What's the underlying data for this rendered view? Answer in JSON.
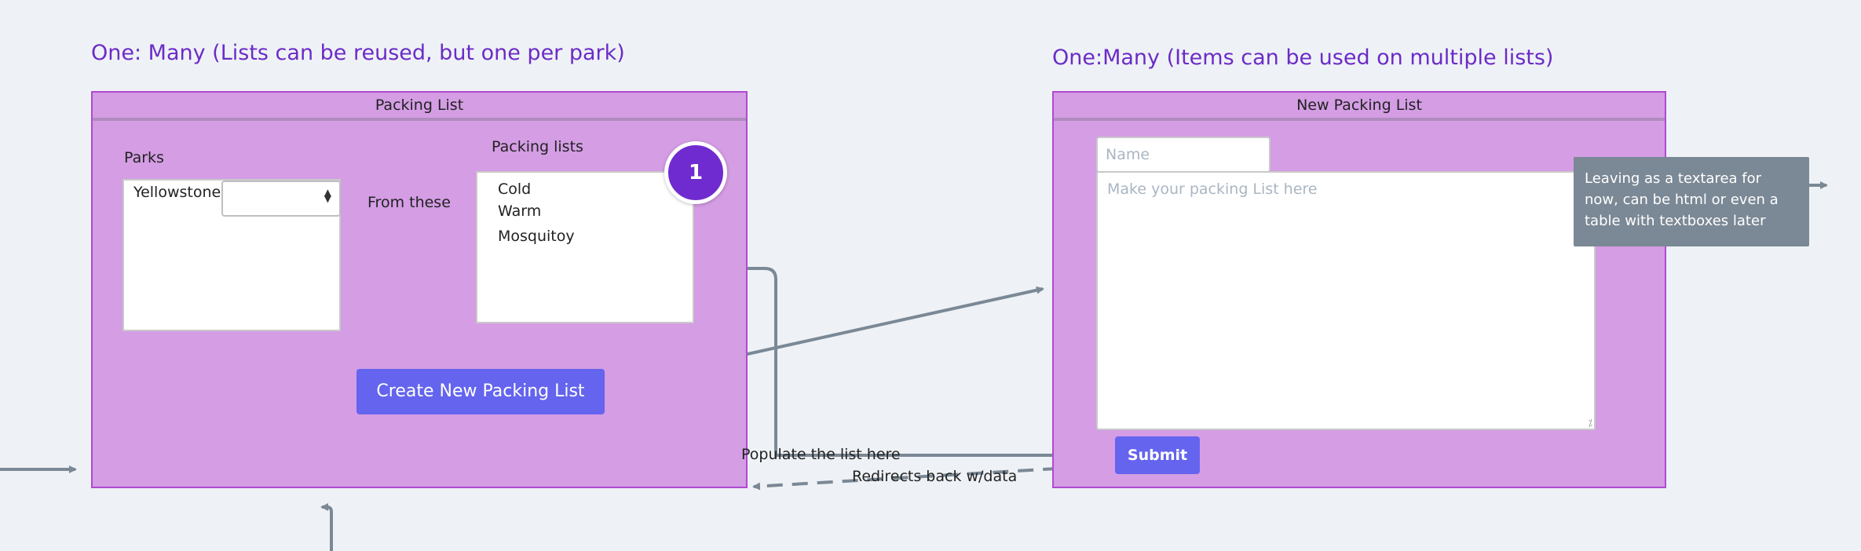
{
  "left_section": {
    "heading": "One: Many (Lists can be reused, but one per park)",
    "frame_title": "Packing List",
    "parks_label": "Parks",
    "park_item": "Yellowstone",
    "select_value": "",
    "lists_label": "Packing lists",
    "list_items": [
      "Cold",
      "Warm",
      "Mosquitoy"
    ],
    "badge_number": "1",
    "create_button": "Create  New Packing List"
  },
  "right_section": {
    "heading": "One:Many (Items can be used on multiple lists)",
    "frame_title": "New Packing List",
    "name_placeholder": "Name",
    "textarea_placeholder": "Make your packing List here",
    "submit_button": "Submit",
    "tooltip": "Leaving as a textarea for now, can be html or even a table with textboxes later"
  },
  "connectors": {
    "from_these": "From these",
    "populate": "Populate the list here",
    "redirects": "Redirects back w/data"
  },
  "colors": {
    "frame_fill": "#d49de4",
    "frame_border": "#b04ad0",
    "heading": "#6c2bc7",
    "button": "#6464ee",
    "badge": "#6f2bd0",
    "connector": "#7b8895",
    "tooltip": "#7b8895"
  }
}
